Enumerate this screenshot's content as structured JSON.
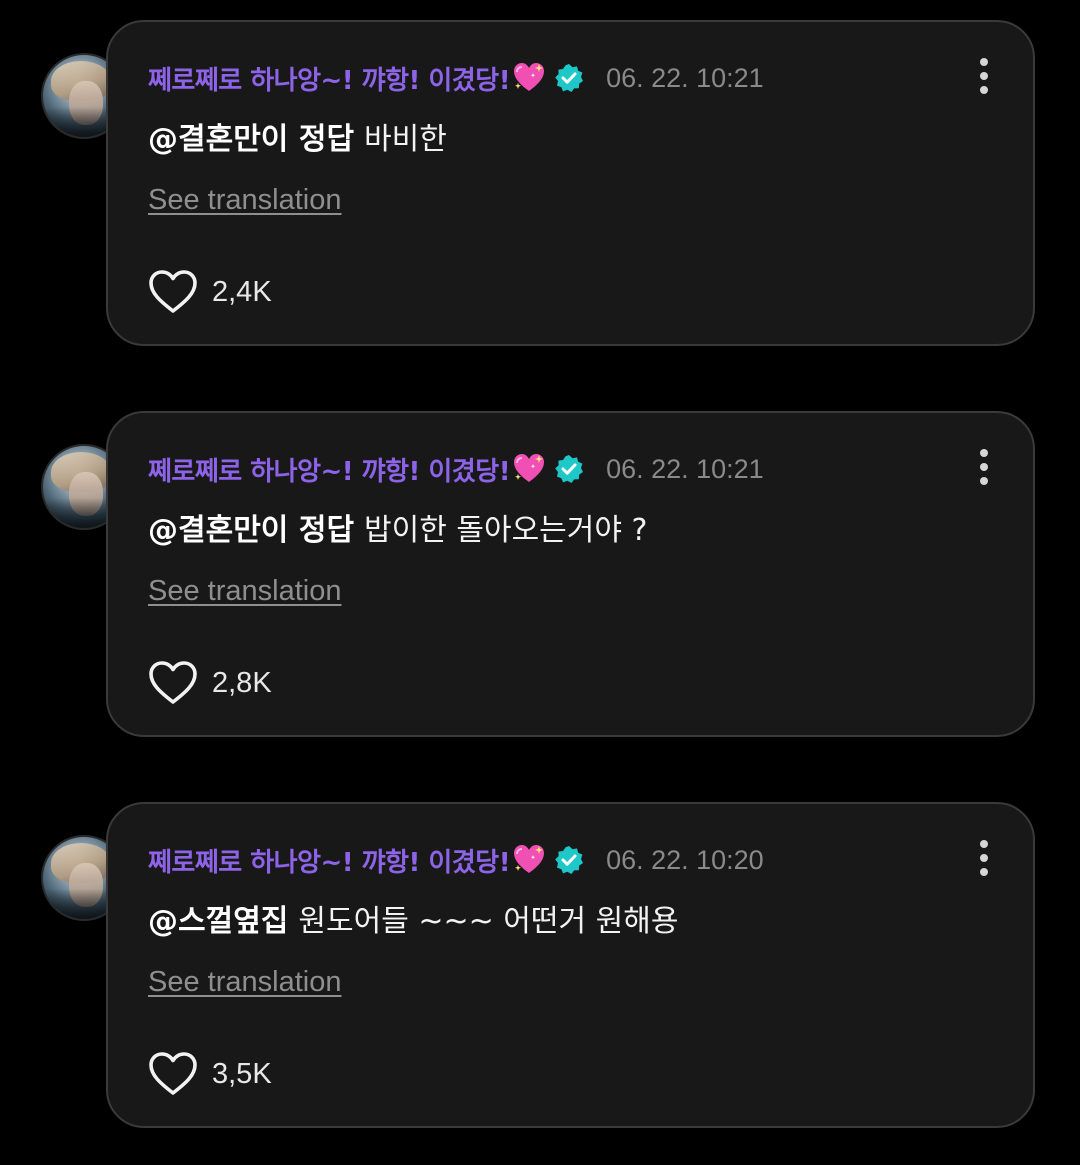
{
  "comments": [
    {
      "username": "쩨로쩨로 하나앙~! 꺄항! 이겼당!",
      "timestamp": "06. 22. 10:21",
      "mention": "@결혼만이 정답",
      "text": "바비한",
      "translate_label": "See translation",
      "likes": "2,4K"
    },
    {
      "username": "쩨로쩨로 하나앙~! 꺄항! 이겼당!",
      "timestamp": "06. 22. 10:21",
      "mention": "@결혼만이 정답",
      "text": "밥이한 돌아오는거야 ?",
      "translate_label": "See translation",
      "likes": "2,8K"
    },
    {
      "username": "쩨로쩨로 하나앙~! 꺄항! 이겼당!",
      "timestamp": "06. 22. 10:20",
      "mention": "@스껄옆집",
      "text": "원도어들 ~~~ 어떤거 원해용",
      "translate_label": "See translation",
      "likes": "3,5K"
    }
  ],
  "icons": {
    "username_emoji": "sparkling-heart-icon",
    "verified": "verified-badge-icon",
    "more": "more-vertical-icon",
    "like": "heart-outline-icon"
  },
  "colors": {
    "background": "#000000",
    "card": "#181818",
    "card_border": "#3a3a3a",
    "username": "#8d63e8",
    "verified_badge": "#1ec8c8",
    "timestamp": "#8a8a8a",
    "translate": "#8f8f8f"
  }
}
